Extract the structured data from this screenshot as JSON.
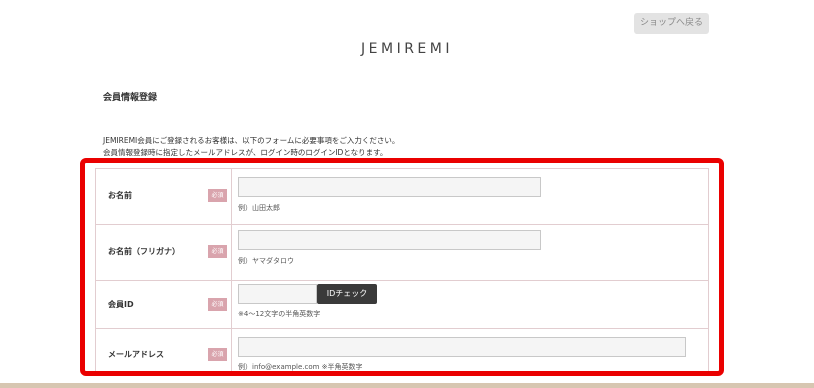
{
  "header": {
    "back_button": "ショップへ戻る",
    "logo": "JEMIREMI"
  },
  "page": {
    "title": "会員情報登録",
    "intro_line1": "JEMIREMI会員にご登録されるお客様は、以下のフォームに必要事項をご入力ください。",
    "intro_line2": "会員情報登録時に指定したメールアドレスが、ログイン時のログインIDとなります。"
  },
  "form": {
    "required_badge": "必須",
    "fields": [
      {
        "label": "お名前",
        "hint": "例）山田太郎",
        "value": ""
      },
      {
        "label": "お名前（フリガナ）",
        "hint": "例）ヤマダタロウ",
        "value": ""
      },
      {
        "label": "会員ID",
        "hint": "※4～12文字の半角英数字",
        "value": "",
        "button": "IDチェック"
      },
      {
        "label": "メールアドレス",
        "hint": "例）info@example.com ※半角英数字",
        "value": ""
      }
    ]
  },
  "colors": {
    "highlight_frame": "#ea0000",
    "required_badge": "#d9a4ad",
    "table_border": "#e2cdd0",
    "bottom_strip": "#d7c6b1"
  }
}
